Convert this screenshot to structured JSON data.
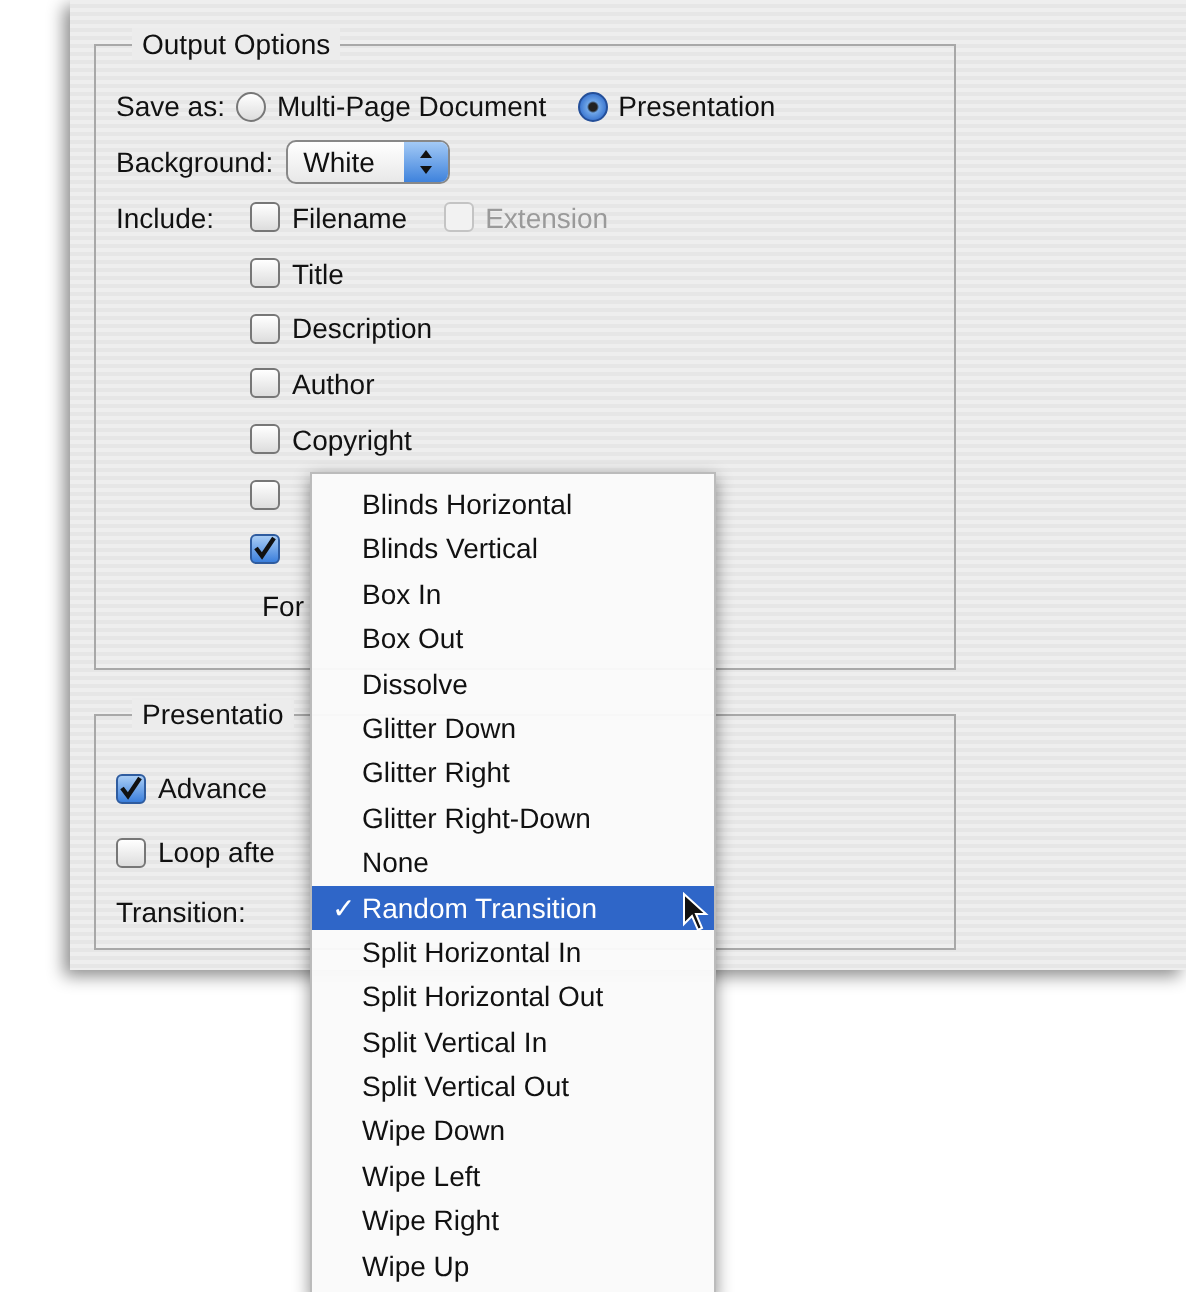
{
  "output_options": {
    "title": "Output Options",
    "save_as": {
      "label": "Save as:",
      "options": [
        {
          "label": "Multi-Page Document",
          "selected": false
        },
        {
          "label": "Presentation",
          "selected": true
        }
      ]
    },
    "background": {
      "label": "Background:",
      "value": "White"
    },
    "include": {
      "label": "Include:",
      "rows": [
        {
          "items": [
            {
              "label": "Filename",
              "checked": false,
              "disabled": false
            },
            {
              "label": "Extension",
              "checked": false,
              "disabled": true
            }
          ]
        },
        {
          "items": [
            {
              "label": "Title",
              "checked": false,
              "disabled": false
            }
          ]
        },
        {
          "items": [
            {
              "label": "Description",
              "checked": false,
              "disabled": false
            }
          ]
        },
        {
          "items": [
            {
              "label": "Author",
              "checked": false,
              "disabled": false
            }
          ]
        },
        {
          "items": [
            {
              "label": "Copyright",
              "checked": false,
              "disabled": false
            }
          ]
        },
        {
          "items": [
            {
              "checked": false,
              "disabled": false
            }
          ]
        },
        {
          "items": [
            {
              "checked": true,
              "disabled": false
            }
          ]
        }
      ]
    },
    "font_label": "For"
  },
  "presentation_options": {
    "title": "Presentatio",
    "items": [
      {
        "label": "Advance",
        "checked": true
      },
      {
        "label": "Loop afte",
        "checked": false
      }
    ],
    "transition_label": "Transition:"
  },
  "menu": {
    "check_mark": "✓",
    "items": [
      {
        "label": "Blinds Horizontal",
        "selected": false
      },
      {
        "label": "Blinds Vertical",
        "selected": false
      },
      {
        "label": "Box In",
        "selected": false
      },
      {
        "label": "Box Out",
        "selected": false
      },
      {
        "label": "Dissolve",
        "selected": false
      },
      {
        "label": "Glitter Down",
        "selected": false
      },
      {
        "label": "Glitter Right",
        "selected": false
      },
      {
        "label": "Glitter Right-Down",
        "selected": false
      },
      {
        "label": "None",
        "selected": false
      },
      {
        "label": "Random Transition",
        "selected": true
      },
      {
        "label": "Split Horizontal In",
        "selected": false
      },
      {
        "label": "Split Horizontal Out",
        "selected": false
      },
      {
        "label": "Split Vertical In",
        "selected": false
      },
      {
        "label": "Split Vertical Out",
        "selected": false
      },
      {
        "label": "Wipe Down",
        "selected": false
      },
      {
        "label": "Wipe Left",
        "selected": false
      },
      {
        "label": "Wipe Right",
        "selected": false
      },
      {
        "label": "Wipe Up",
        "selected": false
      }
    ]
  }
}
